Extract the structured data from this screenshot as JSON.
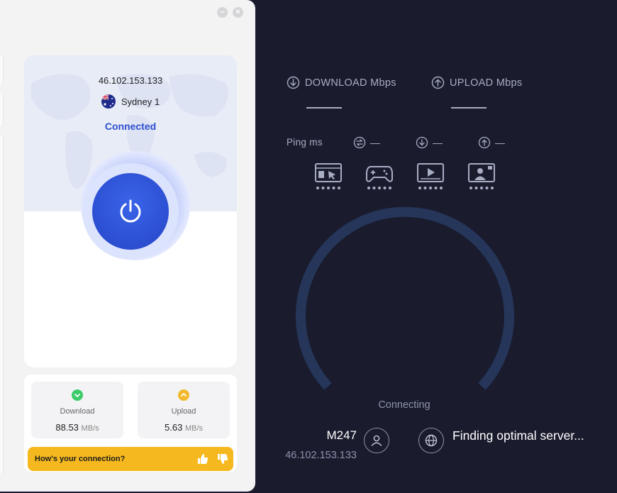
{
  "app": {
    "window_controls": {
      "minimize": "–",
      "close": "×"
    },
    "connection": {
      "ip": "46.102.153.133",
      "server_name": "Sydney 1",
      "status": "Connected"
    },
    "stats": {
      "download": {
        "label": "Download",
        "value": "88.53",
        "unit": "MB/s"
      },
      "upload": {
        "label": "Upload",
        "value": "5.63",
        "unit": "MB/s"
      }
    },
    "feedback": {
      "question": "How's your connection?"
    },
    "icons": {
      "flag": "australia-flag-icon",
      "power": "power-icon",
      "like": "thumbs-up-icon",
      "dislike": "thumbs-down-icon"
    },
    "colors": {
      "accent": "#2f4fcf",
      "download": "#3ccb6a",
      "upload": "#f3b92c",
      "feedback": "#f5b81f"
    }
  },
  "speedtest": {
    "download_label": "DOWNLOAD Mbps",
    "upload_label": "UPLOAD Mbps",
    "ping_label": "Ping  ms",
    "ping_values": {
      "jitter": "—",
      "download": "—",
      "upload": "—"
    },
    "activities": [
      "browsing-icon",
      "gaming-icon",
      "streaming-icon",
      "video-call-icon"
    ],
    "status": "Connecting",
    "isp_name": "M247",
    "isp_ip": "46.102.153.133",
    "server_status": "Finding optimal server...",
    "colors": {
      "background": "#1a1c2e",
      "gauge": "#2a3b61",
      "text": "#a9adc3"
    }
  }
}
